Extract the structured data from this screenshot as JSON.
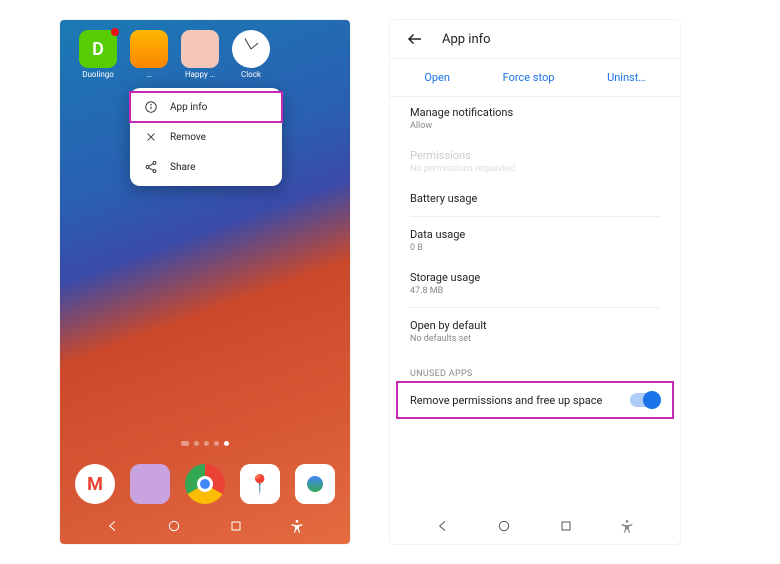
{
  "left": {
    "apps": [
      {
        "label": "Duolingo"
      },
      {
        "label": "…"
      },
      {
        "label": "Happy …"
      },
      {
        "label": "Clock"
      }
    ],
    "popup": [
      {
        "label": "App info",
        "highlight": true
      },
      {
        "label": "Remove",
        "highlight": false
      },
      {
        "label": "Share",
        "highlight": false
      }
    ]
  },
  "right": {
    "header_title": "App info",
    "actions": [
      "Open",
      "Force stop",
      "Uninst…"
    ],
    "rows": [
      {
        "title": "Manage notifications",
        "sub": "Allow"
      },
      {
        "title": "Permissions",
        "sub": "No permissions requested",
        "faded": true
      },
      {
        "title": "Battery usage",
        "sub": ""
      }
    ],
    "rows2": [
      {
        "title": "Data usage",
        "sub": "0 B"
      },
      {
        "title": "Storage usage",
        "sub": "47.8 MB"
      }
    ],
    "rows3": [
      {
        "title": "Open by default",
        "sub": "No defaults set"
      }
    ],
    "section_label": "UNUSED APPS",
    "toggle_label": "Remove permissions and free up space",
    "toggle_on": true
  }
}
